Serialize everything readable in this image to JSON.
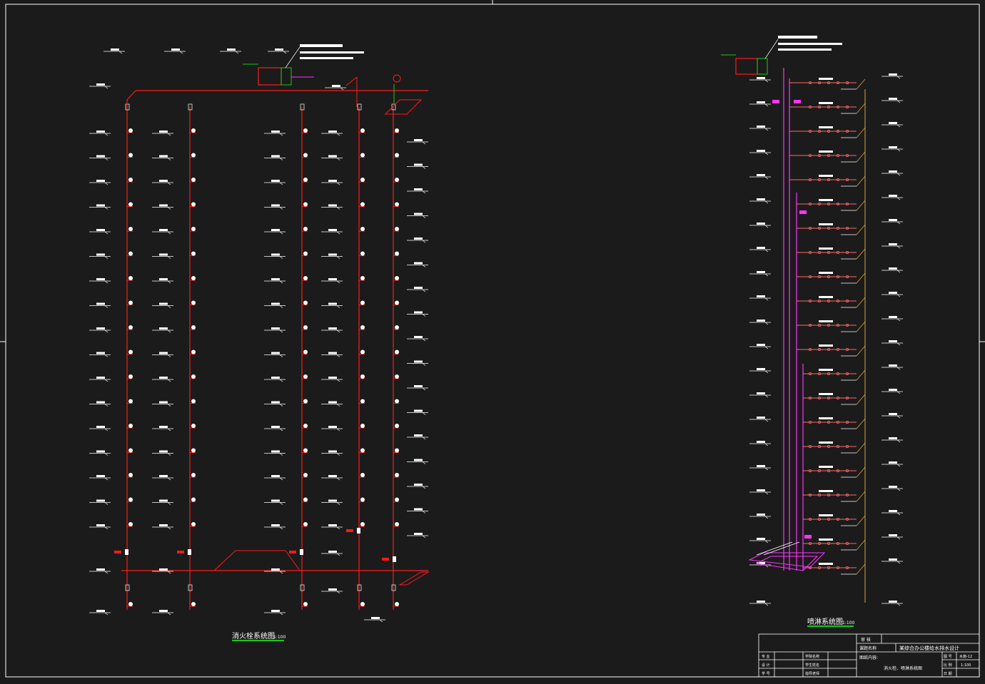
{
  "drawing": {
    "left_title": "消火栓系统图",
    "left_scale": "1:100",
    "right_title": "喷淋系统图",
    "right_scale": "1:100"
  },
  "title_block": {
    "row1_left": "审 核",
    "project_label": "课题名称",
    "project_name": "某综合办公楼给水排水设计",
    "content_label": "图纸内容:",
    "content_value": "消火栓、喷淋系统图",
    "fields": [
      "专 业",
      "设 计",
      "学 号"
    ],
    "mid_fields": [
      "学院名称",
      "学生姓名",
      "指导老师"
    ],
    "right_labels": [
      "图 号",
      "比 例",
      "日 期"
    ],
    "right_values": [
      "水施-12",
      "1:100",
      ""
    ]
  },
  "colors": {
    "background": "#1b1b1b",
    "frame": "#ffffff",
    "hydrant_pipe": "#ff1a1a",
    "sprinkler_pipe": "#ff33ff",
    "sprinkler_branch": "#ff6a6a",
    "drain_pipe": "#e0a040",
    "label": "#ffffff",
    "title_underline": "#19c819"
  },
  "icons": [
    "hydrant-symbol-icon",
    "valve-icon",
    "tank-icon"
  ]
}
